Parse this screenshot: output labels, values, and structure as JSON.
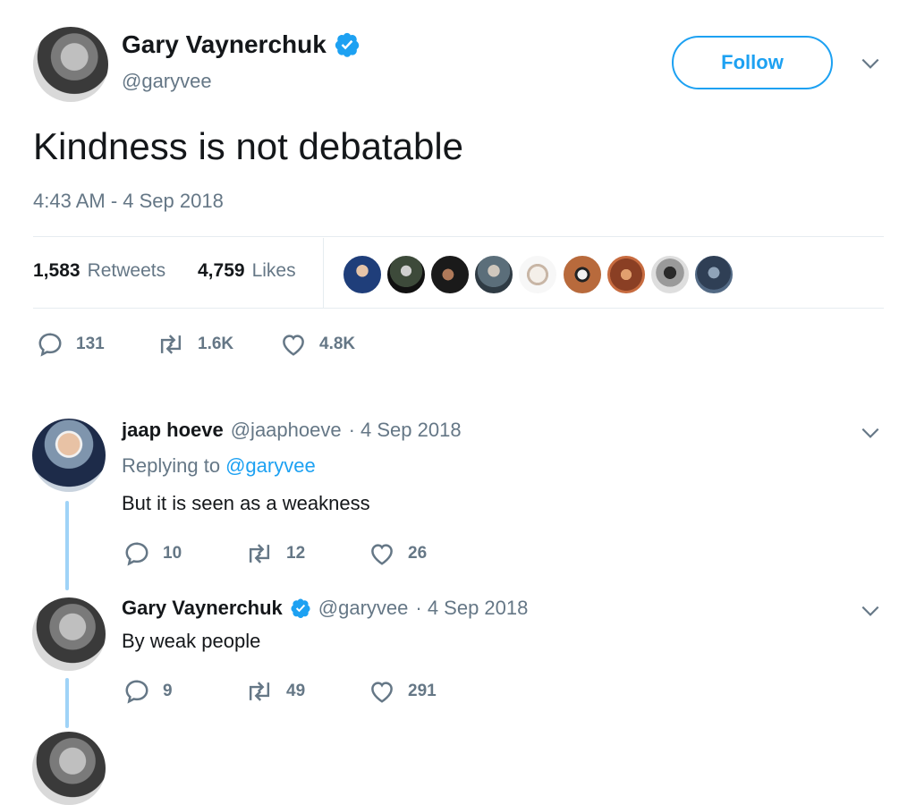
{
  "tweet": {
    "author_name": "Gary Vaynerchuk",
    "author_handle": "@garyvee",
    "follow_label": "Follow",
    "text": "Kindness is not debatable",
    "timestamp": "4:43 AM - 4 Sep 2018",
    "retweets_count": "1,583",
    "retweets_label": "Retweets",
    "likes_count": "4,759",
    "likes_label": "Likes",
    "replies": "131",
    "retweets_short": "1.6K",
    "likes_short": "4.8K"
  },
  "replies": [
    {
      "author_name": "jaap hoeve",
      "author_handle": "@jaaphoeve",
      "date": "· 4 Sep 2018",
      "replying_prefix": "Replying to",
      "replying_to": "@garyvee",
      "text": "But it is seen as a weakness",
      "replies": "10",
      "retweets": "12",
      "likes": "26"
    },
    {
      "author_name": "Gary Vaynerchuk",
      "author_handle": "@garyvee",
      "date": "· 4 Sep 2018",
      "text": "By weak people",
      "replies": "9",
      "retweets": "49",
      "likes": "291"
    }
  ],
  "colors": {
    "accent": "#1da1f2",
    "muted": "#657786",
    "thread_line": "#9fd3f7"
  },
  "icons": [
    "verified-badge-icon",
    "chevron-down-icon",
    "reply-icon",
    "retweet-icon",
    "like-icon"
  ]
}
